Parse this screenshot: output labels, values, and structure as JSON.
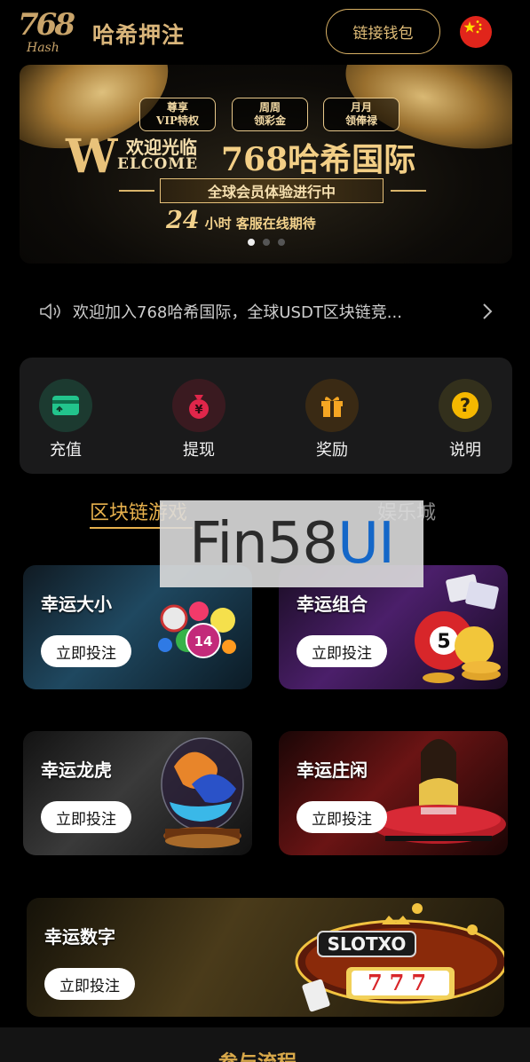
{
  "header": {
    "logo_number": "768",
    "logo_sub": "Hash",
    "site_title": "哈希押注",
    "wallet_button": "链接钱包",
    "language_flag": "china-flag-icon"
  },
  "banner": {
    "badges": [
      "尊享\nVIP特权",
      "周周\n领彩金",
      "月月\n领俸禄"
    ],
    "welcome_letter": "W",
    "welcome_zh": "欢迎光临",
    "welcome_en": "ELCOME",
    "brand": "768哈希国际",
    "slogan": "全球会员体验进行中",
    "service_num": "24",
    "service_text": "小时 客服在线期待",
    "slides_total": 3,
    "slide_active": 1
  },
  "notice": {
    "text": "欢迎加入768哈希国际，全球USDT区块链竞...",
    "icon": "speaker-icon"
  },
  "actions": [
    {
      "label": "充值",
      "icon": "card-icon",
      "color": "#20c08a",
      "bg": "#1e3a30"
    },
    {
      "label": "提现",
      "icon": "money-bag-icon",
      "color": "#e0264a",
      "bg": "#3a1a20"
    },
    {
      "label": "奖励",
      "icon": "gift-icon",
      "color": "#f5a623",
      "bg": "#3a2a14"
    },
    {
      "label": "说明",
      "icon": "question-icon",
      "color": "#f5b800",
      "bg": "#33301c"
    }
  ],
  "tabs": {
    "active": "区块链游戏",
    "inactive": "娱乐城"
  },
  "watermark": {
    "part_a": "Fin58",
    "part_b": "UI"
  },
  "games": [
    {
      "name": "幸运大小",
      "button": "立即投注",
      "art": "lottery-balls-icon"
    },
    {
      "name": "幸运组合",
      "button": "立即投注",
      "art": "lottery-ball-coins-icon"
    },
    {
      "name": "幸运龙虎",
      "button": "立即投注",
      "art": "dragon-tiger-icon"
    },
    {
      "name": "幸运庄闲",
      "button": "立即投注",
      "art": "baccarat-dealer-icon"
    },
    {
      "name": "幸运数字",
      "button": "立即投注",
      "art": "slot-machine-icon",
      "slot_text": "SLOTXO",
      "slot_digits": "777"
    }
  ],
  "footer": {
    "title": "参与流程"
  }
}
